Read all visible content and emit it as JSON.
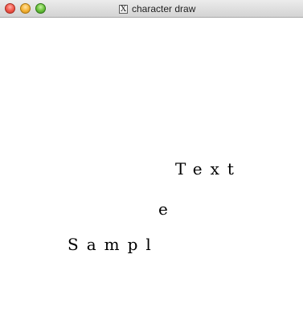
{
  "window": {
    "title": "character draw",
    "title_icon_glyph": "X"
  },
  "controls": {
    "close_glyph": "",
    "minimize_glyph": "",
    "zoom_glyph": ""
  },
  "canvas": {
    "lines": [
      "Text",
      "e",
      "Sampl"
    ]
  }
}
